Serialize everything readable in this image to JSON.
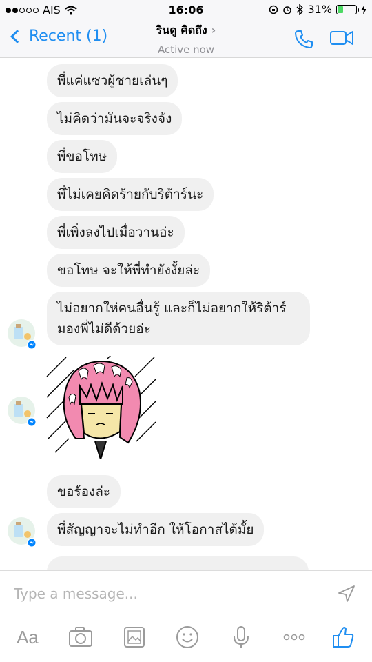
{
  "status_bar": {
    "carrier": "AIS",
    "time": "16:06",
    "battery": "31%",
    "battery_level": 0.31
  },
  "header": {
    "back_label": "Recent (1)",
    "contact_name": "รินดู คิดถึง",
    "status": "Active now",
    "icons": [
      "phone-icon",
      "video-camera-icon"
    ]
  },
  "messages": [
    "พี่แค่แซวผู้ชายเล่นๆ",
    "ไม่คิดว่ามันจะจริงจัง",
    "พี่ขอโทษ",
    "พี่ไม่เคยคิดร้ายกับริต้าร์นะ",
    "พี่เพิ่งลงไปเมื่อวานอ่ะ",
    "ขอโทษ จะให้พี่ทำยังงั้ยล่ะ",
    "ไม่อยากให่คนอื่นรู้ และก็ไม่อยากให้ริต้าร์มองพี่ไม่ดีด้วยอ่ะ",
    "ขอร้องล่ะ",
    "พี่สัญญาจะไม่ทำอีก ให้โอกาสได้มั้ย"
  ],
  "composer": {
    "placeholder": "Type a message...",
    "aa_label": "Aa",
    "toolbar_icons": [
      "text-size-icon",
      "camera-icon",
      "gallery-icon",
      "emoji-icon",
      "microphone-icon",
      "more-icon",
      "like-icon"
    ]
  },
  "colors": {
    "accent": "#1f8ef1",
    "bubble": "#f0f0f0",
    "messenger_badge": "#0084ff",
    "icon_gray": "#9b9b9b"
  }
}
